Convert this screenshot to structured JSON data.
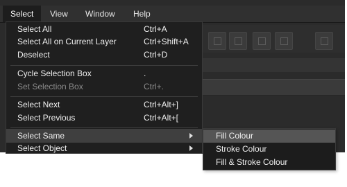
{
  "menubar": {
    "items": [
      "Select",
      "View",
      "Window",
      "Help"
    ]
  },
  "select_menu": {
    "items": [
      {
        "label": "Select All",
        "shortcut": "Ctrl+A"
      },
      {
        "label": "Select All on Current Layer",
        "shortcut": "Ctrl+Shift+A"
      },
      {
        "label": "Deselect",
        "shortcut": "Ctrl+D"
      },
      {
        "label": "Cycle Selection Box",
        "shortcut": "."
      },
      {
        "label": "Set Selection Box",
        "shortcut": "Ctrl+.",
        "disabled": true
      },
      {
        "label": "Select Next",
        "shortcut": "Ctrl+Alt+]"
      },
      {
        "label": "Select Previous",
        "shortcut": "Ctrl+Alt+["
      },
      {
        "label": "Select Same",
        "submenu": true,
        "highlighted": true
      },
      {
        "label": "Select Object",
        "submenu": true
      }
    ]
  },
  "select_same_submenu": {
    "items": [
      {
        "label": "Fill Colour",
        "highlighted": true
      },
      {
        "label": "Stroke Colour"
      },
      {
        "label": "Fill & Stroke Colour"
      }
    ]
  }
}
